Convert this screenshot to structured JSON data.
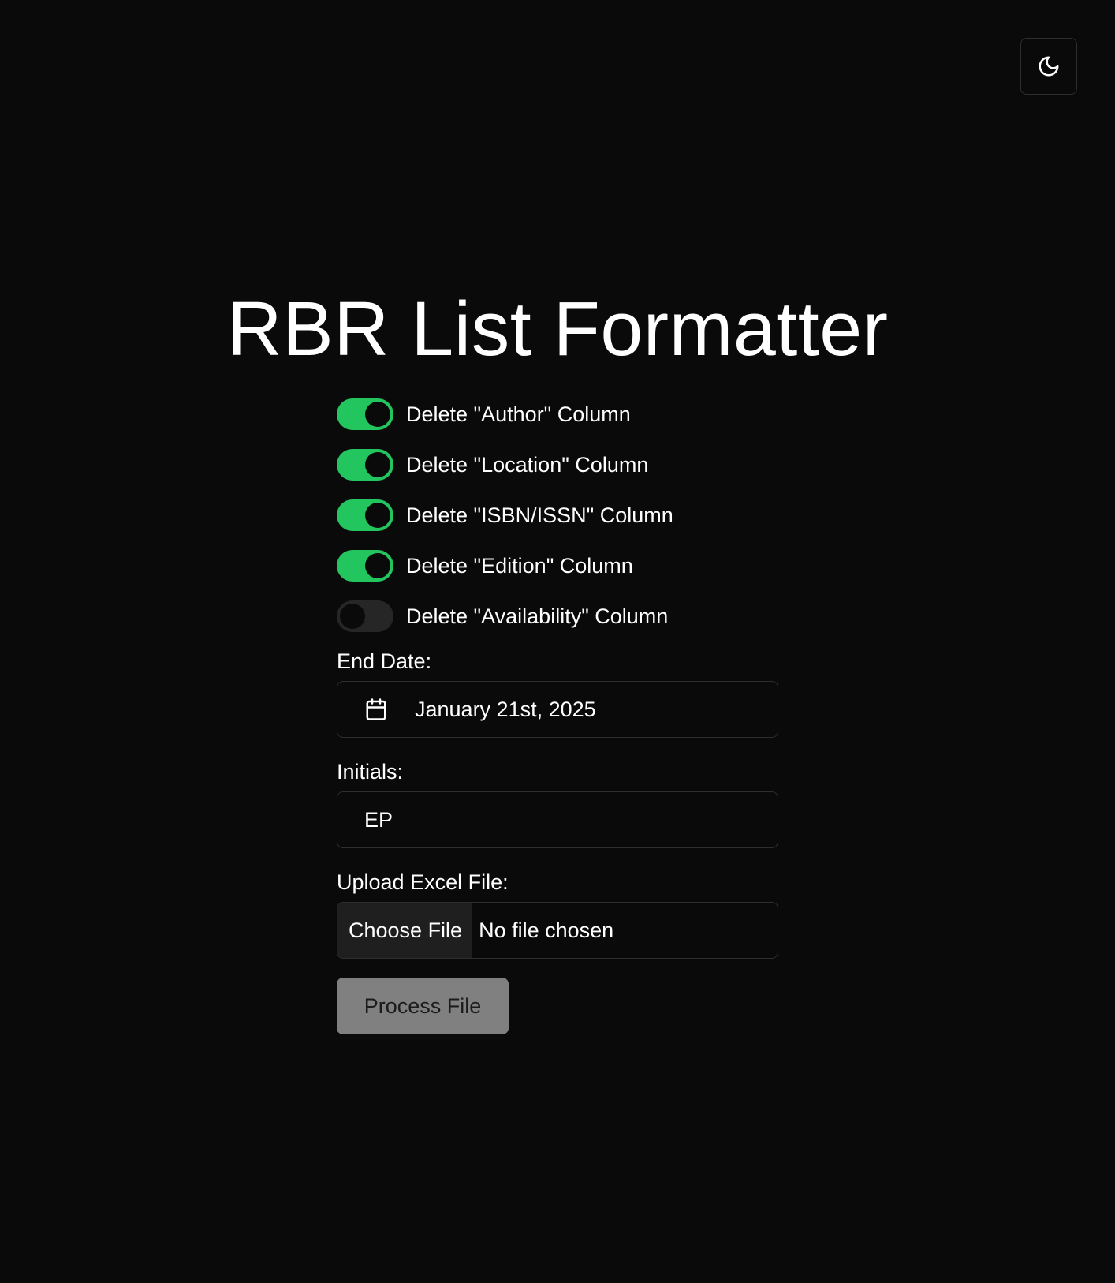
{
  "header": {
    "theme_toggle_icon": "moon-icon"
  },
  "title": "RBR List Formatter",
  "toggles": [
    {
      "label": "Delete \"Author\" Column",
      "on": true
    },
    {
      "label": "Delete \"Location\" Column",
      "on": true
    },
    {
      "label": "Delete \"ISBN/ISSN\" Column",
      "on": true
    },
    {
      "label": "Delete \"Edition\" Column",
      "on": true
    },
    {
      "label": "Delete \"Availability\" Column",
      "on": false
    }
  ],
  "end_date": {
    "label": "End Date:",
    "value": "January 21st, 2025",
    "icon": "calendar-icon"
  },
  "initials": {
    "label": "Initials:",
    "value": "EP"
  },
  "upload": {
    "label": "Upload Excel File:",
    "button_label": "Choose File",
    "status": "No file chosen"
  },
  "process_button_label": "Process File",
  "colors": {
    "background": "#0a0a0a",
    "toggle_on": "#22c55e",
    "toggle_off": "#262626",
    "border": "#2e2e2e",
    "process_button": "#808080"
  }
}
